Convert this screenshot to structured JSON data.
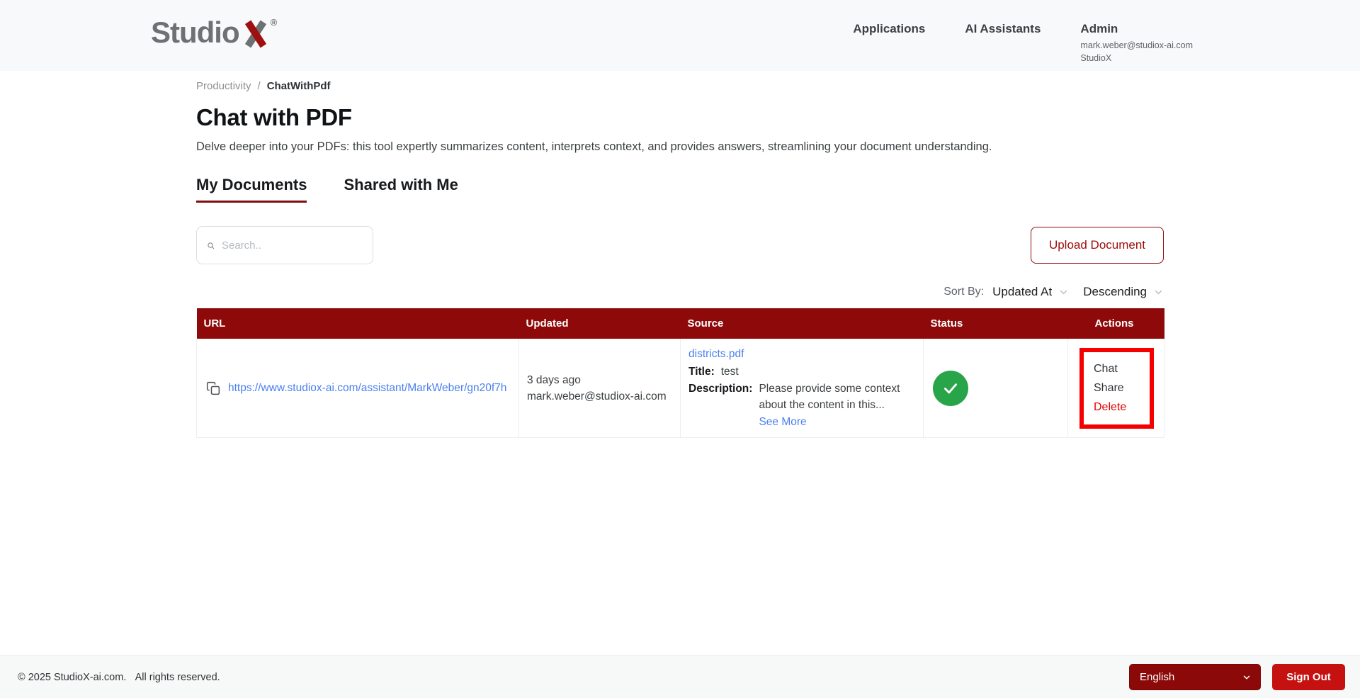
{
  "header": {
    "logo_studio": "Studio",
    "logo_x": "X",
    "logo_reg": "®",
    "nav": {
      "applications": "Applications",
      "ai_assistants": "AI Assistants"
    },
    "user": {
      "name": "Admin",
      "email": "mark.weber@studiox-ai.com",
      "org": "StudioX"
    }
  },
  "breadcrumb": {
    "parent": "Productivity",
    "separator": "/",
    "current": "ChatWithPdf"
  },
  "page": {
    "title": "Chat with PDF",
    "description": "Delve deeper into your PDFs: this tool expertly summarizes content, interprets context, and provides answers, streamlining your document understanding."
  },
  "tabs": {
    "my_documents": "My Documents",
    "shared_with_me": "Shared with Me"
  },
  "toolbar": {
    "search_placeholder": "Search..",
    "upload_label": "Upload Document"
  },
  "sort": {
    "label": "Sort By:",
    "field": "Updated At",
    "direction": "Descending"
  },
  "table": {
    "headers": {
      "url": "URL",
      "updated": "Updated",
      "source": "Source",
      "status": "Status",
      "actions": "Actions"
    },
    "row": {
      "url": "https://www.studiox-ai.com/assistant/MarkWeber/gn20f7h",
      "updated_relative": "3 days ago",
      "updated_by": "mark.weber@studiox-ai.com",
      "source_file": "districts.pdf",
      "title_label": "Title:",
      "title_value": "test",
      "description_label": "Description:",
      "description_value": "Please provide some context about the content in this...",
      "see_more_label": "See More",
      "status": "completed",
      "status_icon": "check-icon",
      "actions": {
        "chat": "Chat",
        "share": "Share",
        "delete": "Delete"
      }
    }
  },
  "footer": {
    "copyright": "© 2025 StudioX-ai.com.",
    "rights": "All rights reserved.",
    "language": "English",
    "signout": "Sign Out"
  },
  "colors": {
    "brand_dark_red": "#8E0A0A",
    "tab_underline_red": "#7E0D0D",
    "annotation_red": "#F40000",
    "link_blue": "#4B80F0",
    "success_green": "#28A548",
    "delete_red": "#E30000",
    "signout_red": "#C61111"
  }
}
